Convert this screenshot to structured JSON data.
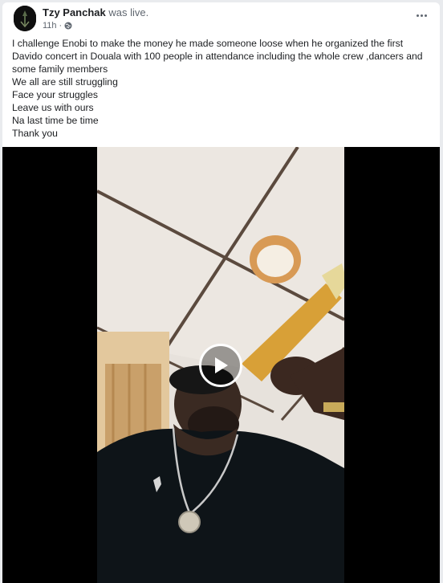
{
  "post": {
    "author": "Tzy Panchak",
    "action": "was live.",
    "timestamp": "11h",
    "privacy_icon": "globe-icon",
    "more_icon": "ellipsis-icon",
    "text_lines": [
      "I challenge Enobi to make the money he made someone loose when he organized the first Davido concert in Douala with 100 people in attendance including the whole crew ,dancers and some family members",
      "We all are still struggling",
      "Face your struggles",
      "Leave us with ours",
      "Na last time be time",
      "Thank you"
    ]
  },
  "video": {
    "play_icon": "play-icon"
  },
  "colors": {
    "page_bg": "#e9ebee",
    "card_bg": "#ffffff",
    "text": "#1c1e21",
    "secondary_text": "#606770"
  }
}
